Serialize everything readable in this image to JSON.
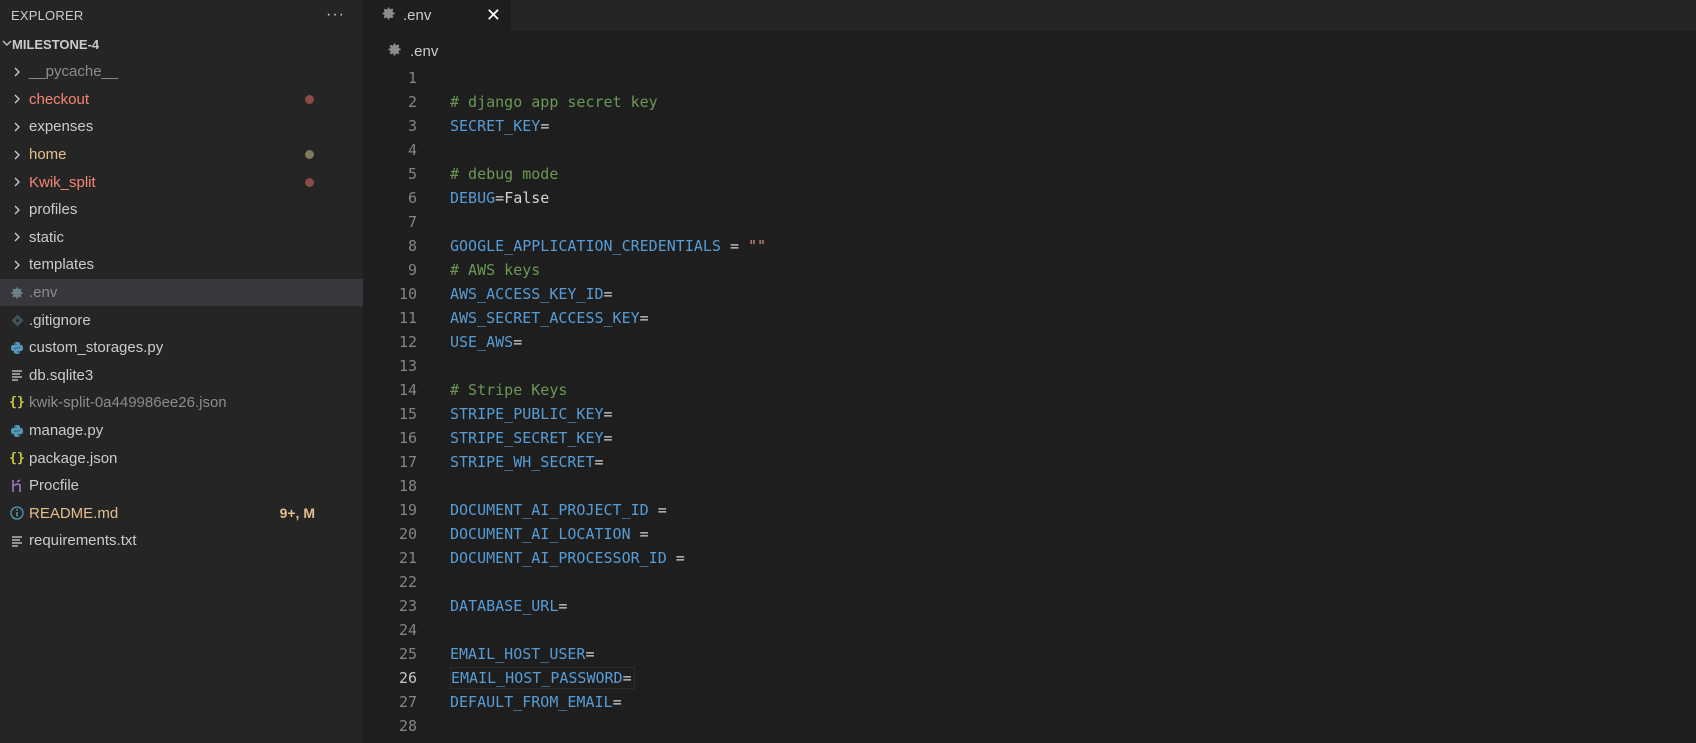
{
  "colors": {
    "modified": "#e2c08d",
    "untracked_red": "#f48771",
    "dot_red": "#8c4a45",
    "dot_yellow": "#7f7a5a",
    "json_icon": "#cbcb41",
    "python_icon": "#519aba",
    "heroku_icon": "#a074c4",
    "readme_icon": "#519aba",
    "gear_icon": "#6d8086",
    "git_icon": "#41535b"
  },
  "sidebar": {
    "title": "EXPLORER",
    "more": "···",
    "project": "MILESTONE-4",
    "items": [
      {
        "label": "__pycache__",
        "kind": "folder",
        "color": "#8c8c8c"
      },
      {
        "label": "checkout",
        "kind": "folder",
        "color": "#f48771",
        "dot": "#8c4a45"
      },
      {
        "label": "expenses",
        "kind": "folder",
        "color": "#cccccc"
      },
      {
        "label": "home",
        "kind": "folder",
        "color": "#e2c08d",
        "dot": "#7f7a5a"
      },
      {
        "label": "Kwik_split",
        "kind": "folder",
        "color": "#f48771",
        "dot": "#8c4a45"
      },
      {
        "label": "profiles",
        "kind": "folder",
        "color": "#cccccc"
      },
      {
        "label": "static",
        "kind": "folder",
        "color": "#cccccc"
      },
      {
        "label": "templates",
        "kind": "folder",
        "color": "#cccccc"
      },
      {
        "label": ".env",
        "kind": "gear",
        "color": "#8c8c8c",
        "selected": true
      },
      {
        "label": ".gitignore",
        "kind": "git",
        "color": "#cccccc"
      },
      {
        "label": "custom_storages.py",
        "kind": "python",
        "color": "#cccccc"
      },
      {
        "label": "db.sqlite3",
        "kind": "lines",
        "color": "#cccccc"
      },
      {
        "label": "kwik-split-0a449986ee26.json",
        "kind": "json",
        "color": "#8c8c8c"
      },
      {
        "label": "manage.py",
        "kind": "python",
        "color": "#cccccc"
      },
      {
        "label": "package.json",
        "kind": "json",
        "color": "#cccccc"
      },
      {
        "label": "Procfile",
        "kind": "heroku",
        "color": "#cccccc"
      },
      {
        "label": "README.md",
        "kind": "info",
        "color": "#e2c08d",
        "badge": "9+, M"
      },
      {
        "label": "requirements.txt",
        "kind": "lines",
        "color": "#cccccc"
      }
    ]
  },
  "tab": {
    "label": ".env",
    "close": "✕"
  },
  "breadcrumb": {
    "label": ".env"
  },
  "editor": {
    "active_line": 26,
    "lines": [
      {
        "n": "1",
        "parts": []
      },
      {
        "n": "2",
        "parts": [
          {
            "t": "c",
            "v": "# django app secret key"
          }
        ]
      },
      {
        "n": "3",
        "parts": [
          {
            "t": "k",
            "v": "SECRET_KEY"
          },
          {
            "t": "o",
            "v": "="
          }
        ]
      },
      {
        "n": "4",
        "parts": []
      },
      {
        "n": "5",
        "parts": [
          {
            "t": "c",
            "v": "# debug mode"
          }
        ]
      },
      {
        "n": "6",
        "parts": [
          {
            "t": "k",
            "v": "DEBUG"
          },
          {
            "t": "o",
            "v": "="
          },
          {
            "t": "v",
            "v": "False"
          }
        ]
      },
      {
        "n": "7",
        "parts": []
      },
      {
        "n": "8",
        "parts": [
          {
            "t": "k",
            "v": "GOOGLE_APPLICATION_CREDENTIALS"
          },
          {
            "t": "o",
            "v": " = "
          },
          {
            "t": "s",
            "v": "\"\""
          }
        ]
      },
      {
        "n": "9",
        "parts": [
          {
            "t": "c",
            "v": "# AWS keys"
          }
        ]
      },
      {
        "n": "10",
        "parts": [
          {
            "t": "k",
            "v": "AWS_ACCESS_KEY_ID"
          },
          {
            "t": "o",
            "v": "="
          }
        ]
      },
      {
        "n": "11",
        "parts": [
          {
            "t": "k",
            "v": "AWS_SECRET_ACCESS_KEY"
          },
          {
            "t": "o",
            "v": "="
          }
        ]
      },
      {
        "n": "12",
        "parts": [
          {
            "t": "k",
            "v": "USE_AWS"
          },
          {
            "t": "o",
            "v": "="
          }
        ]
      },
      {
        "n": "13",
        "parts": []
      },
      {
        "n": "14",
        "parts": [
          {
            "t": "c",
            "v": "# Stripe Keys"
          }
        ]
      },
      {
        "n": "15",
        "parts": [
          {
            "t": "k",
            "v": "STRIPE_PUBLIC_KEY"
          },
          {
            "t": "o",
            "v": "="
          }
        ]
      },
      {
        "n": "16",
        "parts": [
          {
            "t": "k",
            "v": "STRIPE_SECRET_KEY"
          },
          {
            "t": "o",
            "v": "="
          }
        ]
      },
      {
        "n": "17",
        "parts": [
          {
            "t": "k",
            "v": "STRIPE_WH_SECRET"
          },
          {
            "t": "o",
            "v": "="
          }
        ]
      },
      {
        "n": "18",
        "parts": []
      },
      {
        "n": "19",
        "parts": [
          {
            "t": "k",
            "v": "DOCUMENT_AI_PROJECT_ID"
          },
          {
            "t": "o",
            "v": " ="
          }
        ]
      },
      {
        "n": "20",
        "parts": [
          {
            "t": "k",
            "v": "DOCUMENT_AI_LOCATION"
          },
          {
            "t": "o",
            "v": " ="
          }
        ]
      },
      {
        "n": "21",
        "parts": [
          {
            "t": "k",
            "v": "DOCUMENT_AI_PROCESSOR_ID"
          },
          {
            "t": "o",
            "v": " ="
          }
        ]
      },
      {
        "n": "22",
        "parts": []
      },
      {
        "n": "23",
        "parts": [
          {
            "t": "k",
            "v": "DATABASE_URL"
          },
          {
            "t": "o",
            "v": "="
          }
        ]
      },
      {
        "n": "24",
        "parts": []
      },
      {
        "n": "25",
        "parts": [
          {
            "t": "k",
            "v": "EMAIL_HOST_USER"
          },
          {
            "t": "o",
            "v": "="
          }
        ]
      },
      {
        "n": "26",
        "parts": [
          {
            "t": "k",
            "v": "EMAIL_HOST_PASSWORD"
          },
          {
            "t": "o",
            "v": "="
          }
        ]
      },
      {
        "n": "27",
        "parts": [
          {
            "t": "k",
            "v": "DEFAULT_FROM_EMAIL"
          },
          {
            "t": "o",
            "v": "="
          }
        ]
      },
      {
        "n": "28",
        "parts": []
      }
    ]
  }
}
